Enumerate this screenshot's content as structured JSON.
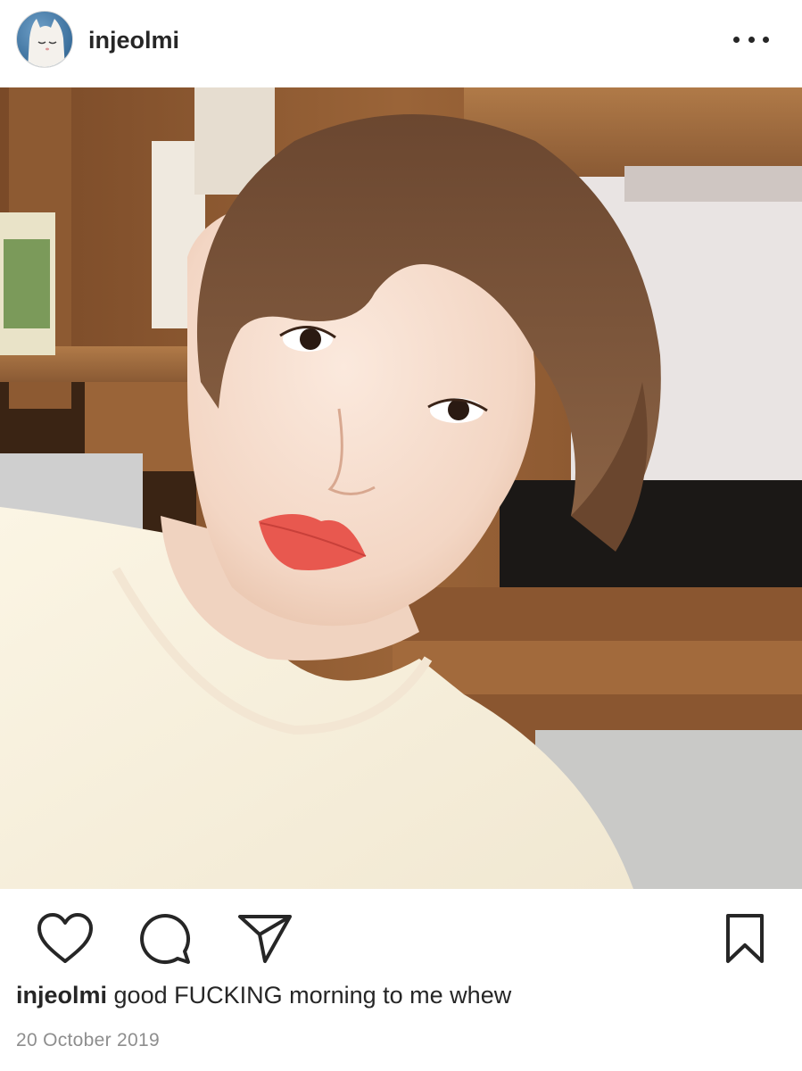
{
  "header": {
    "username": "injeolmi",
    "avatar_icon": "white-cat-avatar",
    "more_icon": "more-horizontal-icon"
  },
  "photo": {
    "subject": "selfie"
  },
  "actions": {
    "like_icon": "heart-icon",
    "comment_icon": "comment-icon",
    "share_icon": "paper-plane-icon",
    "save_icon": "bookmark-icon"
  },
  "caption": {
    "username": "injeolmi",
    "text": "good FUCKING morning to me whew"
  },
  "date": "20 October 2019",
  "colors": {
    "text": "#262626",
    "muted": "#8e8e8e"
  }
}
